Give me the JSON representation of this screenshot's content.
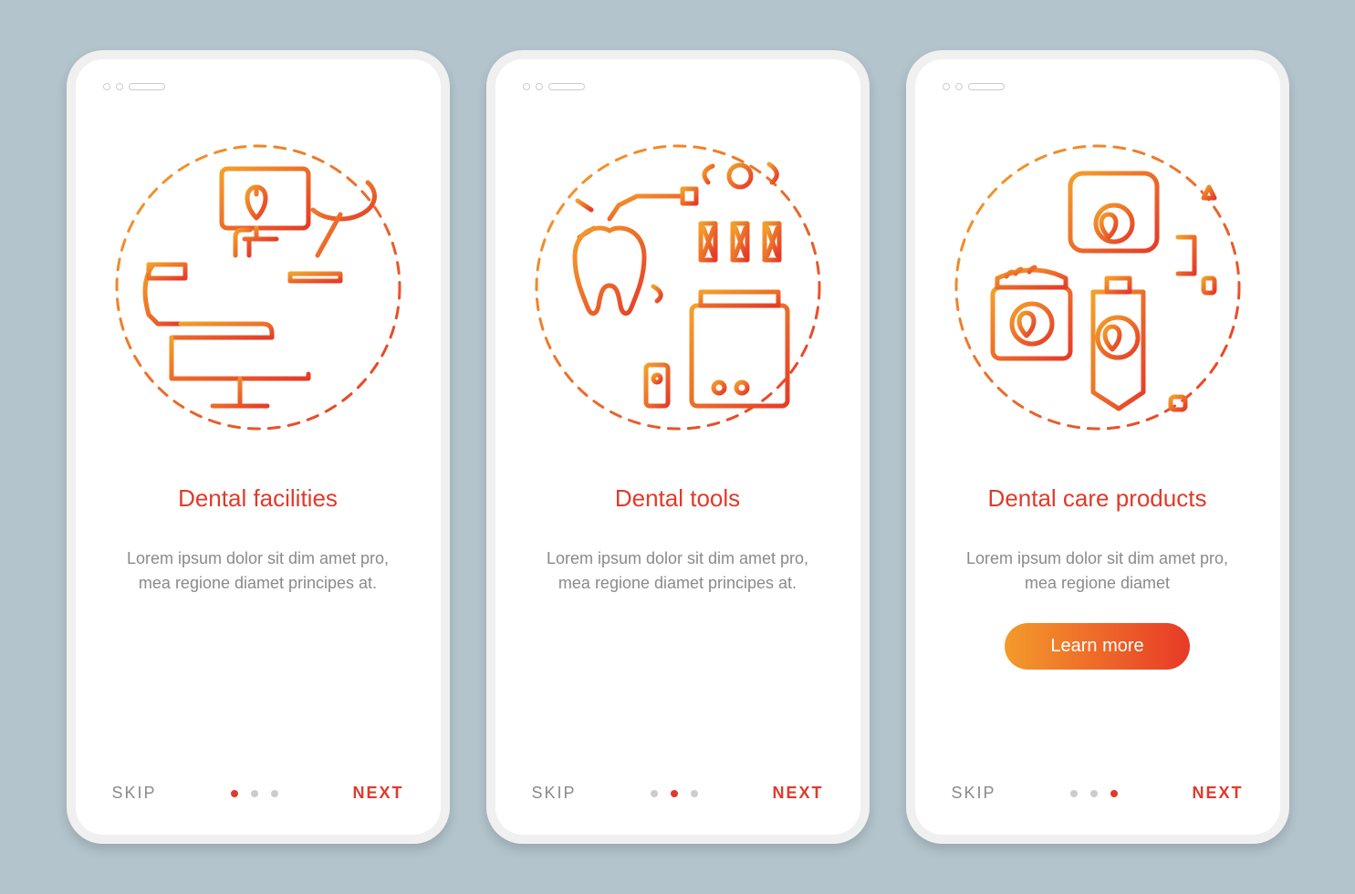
{
  "nav": {
    "skip": "SKIP",
    "next": "NEXT"
  },
  "cta": {
    "label": "Learn more"
  },
  "screens": [
    {
      "title": "Dental facilities",
      "description": "Lorem ipsum dolor sit dim amet pro, mea regione diamet principes at.",
      "active_dot": 0,
      "has_cta": false,
      "icon": "dental-facilities-icon"
    },
    {
      "title": "Dental tools",
      "description": "Lorem ipsum dolor sit dim amet pro, mea regione diamet principes at.",
      "active_dot": 1,
      "has_cta": false,
      "icon": "dental-tools-icon"
    },
    {
      "title": "Dental care products",
      "description": "Lorem ipsum dolor sit dim amet pro, mea regione diamet",
      "active_dot": 2,
      "has_cta": true,
      "icon": "dental-products-icon"
    }
  ]
}
